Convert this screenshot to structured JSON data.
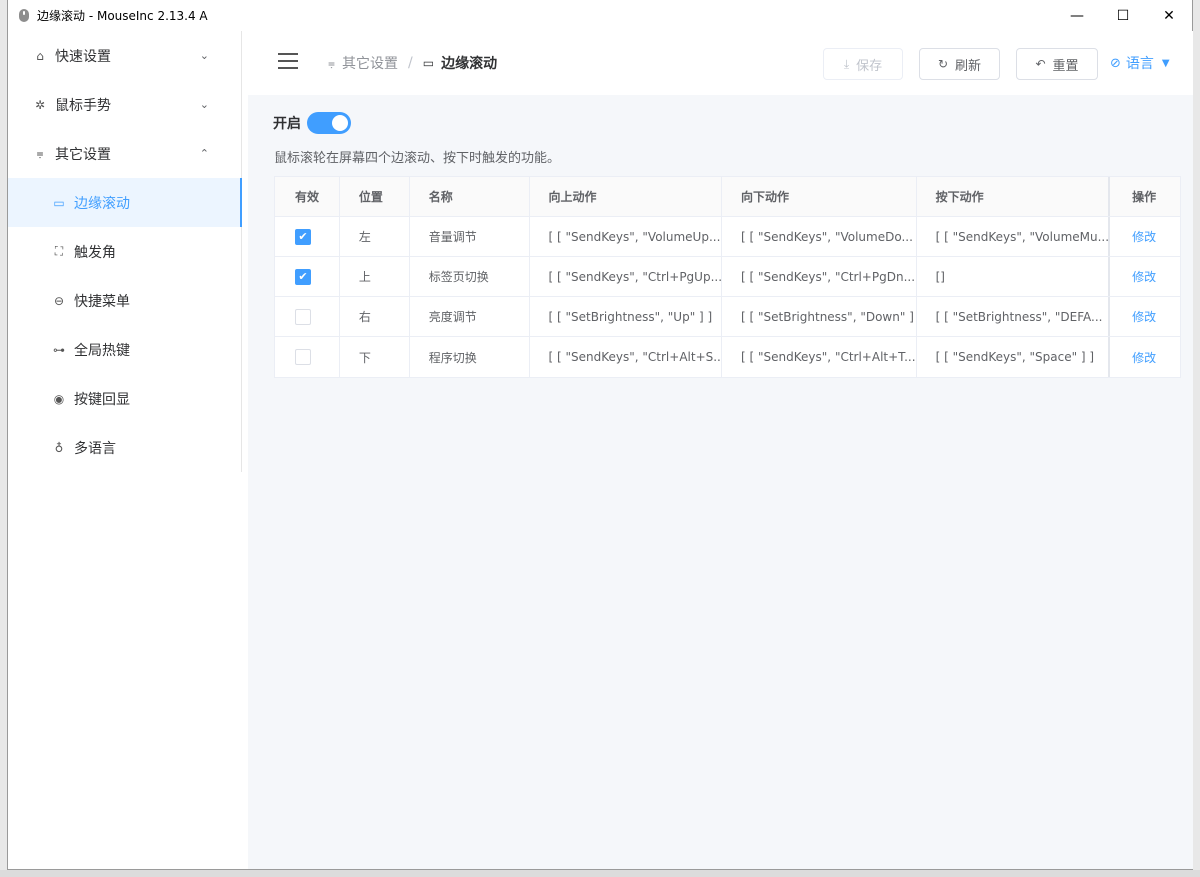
{
  "window": {
    "title": "边缘滚动 - MouseInc 2.13.4 A",
    "controls": {
      "minimize": "—",
      "maximize": "☐",
      "close": "✕"
    }
  },
  "sidebar": {
    "items": [
      {
        "label": "快速设置",
        "icon": "home-icon",
        "glyph": "⌂",
        "arrow": "⌄"
      },
      {
        "label": "鼠标手势",
        "icon": "gear-icon",
        "glyph": "✲",
        "arrow": "⌄"
      },
      {
        "label": "其它设置",
        "icon": "sliders-icon",
        "glyph": "⩦",
        "arrow": "⌃"
      }
    ],
    "subitems": [
      {
        "label": "边缘滚动",
        "icon": "monitor-icon",
        "glyph": "▭",
        "active": true
      },
      {
        "label": "触发角",
        "icon": "corners-icon",
        "glyph": "⛶"
      },
      {
        "label": "快捷菜单",
        "icon": "link-icon",
        "glyph": "⊖"
      },
      {
        "label": "全局热键",
        "icon": "key-icon",
        "glyph": "⊶"
      },
      {
        "label": "按键回显",
        "icon": "eye-icon",
        "glyph": "◉"
      },
      {
        "label": "多语言",
        "icon": "microphone-icon",
        "glyph": "♁"
      }
    ]
  },
  "breadcrumb": {
    "parent": "其它设置",
    "parent_icon": "⩦",
    "separator": "/",
    "current": "边缘滚动",
    "current_icon": "▭"
  },
  "toolbar": {
    "save_label": "保存",
    "save_icon": "⤓",
    "refresh_label": "刷新",
    "refresh_icon": "↻",
    "reset_label": "重置",
    "reset_icon": "↶",
    "language_label": "语言",
    "language_icon": "⊘",
    "language_caret": "▼"
  },
  "settings": {
    "enable_label": "开启",
    "enabled": true,
    "description": "鼠标滚轮在屏幕四个边滚动、按下时触发的功能。"
  },
  "table": {
    "headers": [
      "有效",
      "位置",
      "名称",
      "向上动作",
      "向下动作",
      "按下动作",
      "操作"
    ],
    "rows": [
      {
        "enabled": true,
        "position": "左",
        "name": "音量调节",
        "up": "[ [ \"SendKeys\", \"VolumeUp...",
        "down": "[ [ \"SendKeys\", \"VolumeDo...",
        "press": "[ [ \"SendKeys\", \"VolumeMu...",
        "action": "修改"
      },
      {
        "enabled": true,
        "position": "上",
        "name": "标签页切换",
        "up": "[ [ \"SendKeys\", \"Ctrl+PgUp...",
        "down": "[ [ \"SendKeys\", \"Ctrl+PgDn...",
        "press": "[]",
        "action": "修改"
      },
      {
        "enabled": false,
        "position": "右",
        "name": "亮度调节",
        "up": "[ [ \"SetBrightness\", \"Up\" ] ]",
        "down": "[ [ \"SetBrightness\", \"Down\" ] ]",
        "press": "[ [ \"SetBrightness\", \"DEFA...",
        "action": "修改"
      },
      {
        "enabled": false,
        "position": "下",
        "name": "程序切换",
        "up": "[ [ \"SendKeys\", \"Ctrl+Alt+S...",
        "down": "[ [ \"SendKeys\", \"Ctrl+Alt+T...",
        "press": "[ [ \"SendKeys\", \"Space\" ] ]",
        "action": "修改"
      }
    ]
  },
  "colors": {
    "accent": "#409eff",
    "active_bg": "#ecf5ff",
    "content_bg": "#f5f7fa"
  }
}
